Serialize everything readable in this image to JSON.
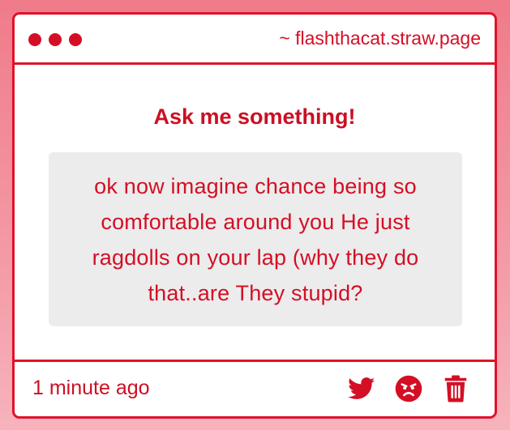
{
  "window": {
    "url": "~ flashthacat.straw.page",
    "dot_color": "#d40f25"
  },
  "main": {
    "heading": "Ask me something!",
    "question": "ok now imagine chance being so comfortable around you He just ragdolls on your lap (why they do that..are They stupid?"
  },
  "footer": {
    "timestamp": "1 minute ago",
    "actions": [
      {
        "icon": "twitter-icon"
      },
      {
        "icon": "angry-face-icon"
      },
      {
        "icon": "trash-icon"
      }
    ]
  },
  "colors": {
    "accent": "#e0122a",
    "background_top": "#f07b8a",
    "background_bottom": "#f7b3bc",
    "question_box": "#ececec"
  }
}
